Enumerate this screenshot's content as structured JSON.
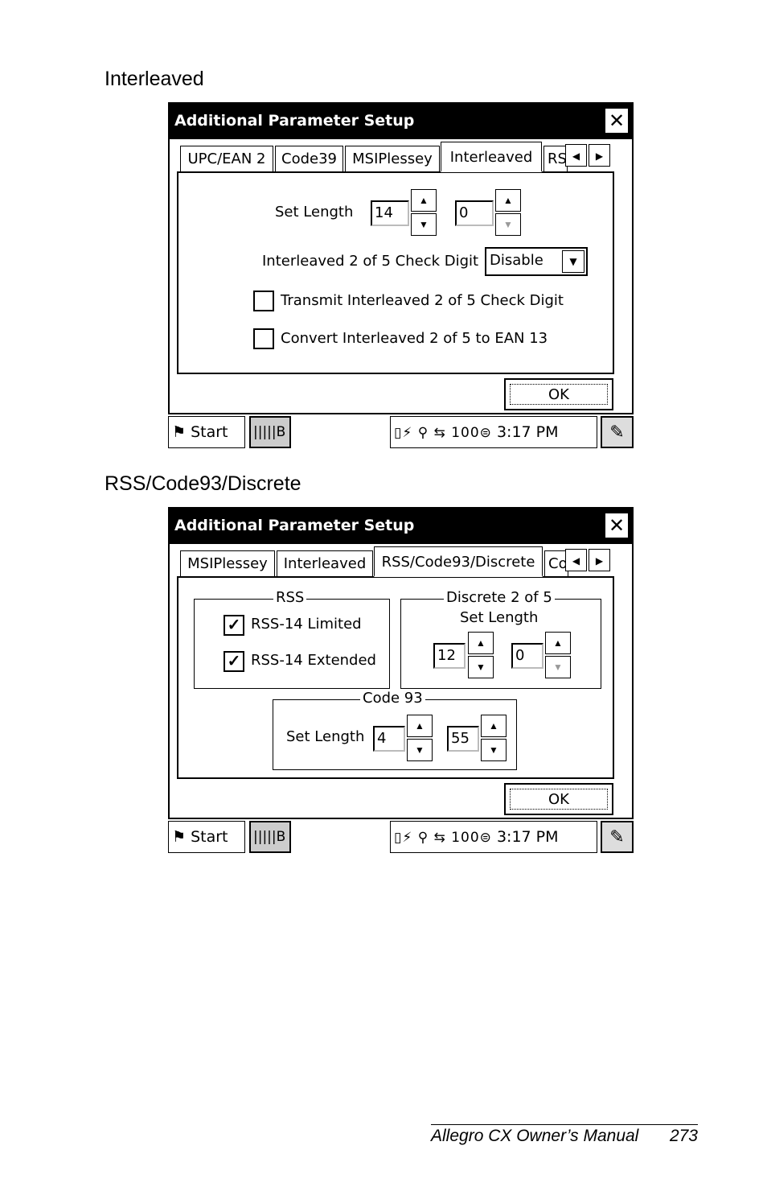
{
  "captions": {
    "first": "Interleaved",
    "second": "RSS/Code93/Discrete"
  },
  "screen1": {
    "title": "Additional Parameter Setup",
    "close": "✕",
    "tabs": [
      "UPC/EAN 2",
      "Code39",
      "MSIPlessey",
      "Interleaved",
      "RS"
    ],
    "active_tab": "Interleaved",
    "set_length_label": "Set Length",
    "set_length_min": "14",
    "set_length_max": "0",
    "check_digit_label": "Interleaved 2 of 5 Check Digit",
    "check_digit_value": "Disable",
    "transmit_label": "Transmit Interleaved 2 of 5 Check Digit",
    "transmit_checked": false,
    "convert_label": "Convert Interleaved 2 of 5 to EAN 13",
    "convert_checked": false,
    "ok": "OK"
  },
  "screen2": {
    "title": "Additional Parameter Setup",
    "close": "✕",
    "tabs": [
      "MSIPlessey",
      "Interleaved",
      "RSS/Code93/Discrete",
      "Co"
    ],
    "active_tab": "RSS/Code93/Discrete",
    "rss_group": "RSS",
    "rss14_limited_label": "RSS-14 Limited",
    "rss14_limited_checked": true,
    "rss14_extended_label": "RSS-14 Extended",
    "rss14_extended_checked": true,
    "discrete_group": "Discrete 2 of 5",
    "discrete_set_length_label": "Set Length",
    "discrete_min": "12",
    "discrete_max": "0",
    "code93_group": "Code 93",
    "code93_set_length_label": "Set Length",
    "code93_min": "4",
    "code93_max": "55",
    "ok": "OK"
  },
  "taskbar": {
    "start": "Start",
    "app": "B",
    "time": "3:17 PM",
    "tray_icons": [
      "battery-icon",
      "power-icon",
      "network-icon",
      "sync-icon",
      "volume-icon",
      "storage-icon"
    ],
    "battery_level_text": "100"
  },
  "footer": {
    "manual": "Allegro CX Owner’s Manual",
    "page": "273"
  },
  "glyphs": {
    "up": "▲",
    "down": "▼",
    "left": "◀",
    "right": "▶",
    "check": "✓"
  }
}
